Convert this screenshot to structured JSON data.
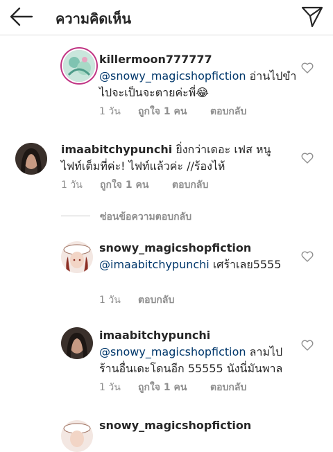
{
  "header": {
    "title": "ความคิดเห็น",
    "back_icon": "arrow-left-icon",
    "send_icon": "paper-plane-icon"
  },
  "comments": [
    {
      "username": "killermoon777777",
      "mention": "@snowy_magicshopfiction",
      "text": " อ่านไปขำไปจะเป็นจะตายค่ะพี่😂",
      "time": "1 วัน",
      "likes": "ถูกใจ 1 คน",
      "reply": "ตอบกลับ"
    },
    {
      "username": "imaabitchypunchi",
      "mention": "",
      "text": " ยิ่งกว่าเดอะ เฟส หนูไฟท์เต็มที่ค่ะ! ไฟท์แล้วค่ะ //ร้องไห้",
      "time": "1 วัน",
      "likes": "ถูกใจ 1 คน",
      "reply": "ตอบกลับ"
    },
    {
      "username": "snowy_magicshopfiction",
      "mention": "@imaabitchypunchi",
      "text": " เศร้าเลย5555",
      "time": "1 วัน",
      "likes": "",
      "reply": "ตอบกลับ"
    },
    {
      "username": "imaabitchypunchi",
      "mention": "@snowy_magicshopfiction",
      "text": " ลามไปร้านอื่นเดะโดนอีก 55555 นังนี่มันพาล",
      "time": "1 วัน",
      "likes": "ถูกใจ 1 คน",
      "reply": "ตอบกลับ"
    },
    {
      "username": "snowy_magicshopfiction",
      "mention": "",
      "text": "",
      "time": "",
      "likes": "",
      "reply": ""
    }
  ],
  "hide_replies": "ซ่อนข้อความตอบกลับ",
  "colors": {
    "text": "#262626",
    "meta": "#8e8e8e",
    "mention": "#00376b",
    "divider": "#dbdbdb"
  }
}
